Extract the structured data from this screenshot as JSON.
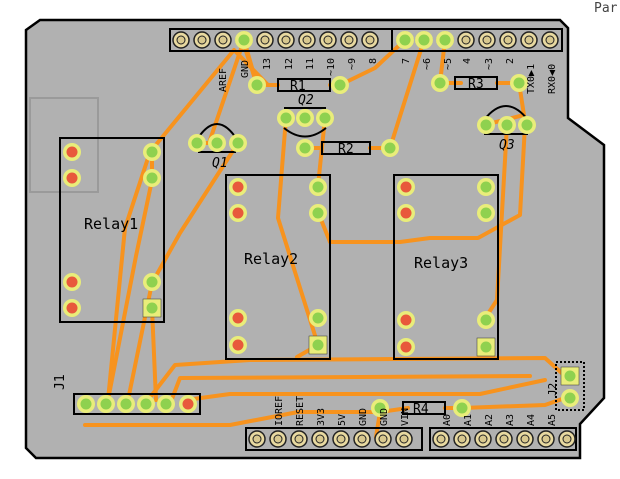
{
  "corner_text": "Par",
  "colors": {
    "board": "#b1b1b1",
    "board_edge": "#000000",
    "trace": "#f7931e",
    "pad_green": "#8fd14f",
    "pad_red": "#e8593c",
    "pad_ring": "#e9ed7a",
    "header_pad": "#e8d9a0",
    "silk": "#000000"
  },
  "top_header_labels": [
    "AREF",
    "GND",
    "13",
    "12",
    "11",
    "~10",
    "~9",
    "8",
    "7",
    "~6",
    "~5",
    "4",
    "~3",
    "2",
    "TX0▶1",
    "RX0◀0"
  ],
  "bottom_header_labels": [
    "IOREF",
    "RESET",
    "3V3",
    "5V",
    "GND",
    "GND",
    "VIN",
    "A0",
    "A1",
    "A2",
    "A3",
    "A4",
    "A5"
  ],
  "relays": [
    {
      "label": "Relay1"
    },
    {
      "label": "Relay2"
    },
    {
      "label": "Relay3"
    }
  ],
  "transistors": [
    {
      "label": "Q1"
    },
    {
      "label": "Q2"
    },
    {
      "label": "Q3"
    }
  ],
  "resistors": [
    {
      "label": "R1"
    },
    {
      "label": "R2"
    },
    {
      "label": "R3"
    },
    {
      "label": "R4"
    }
  ],
  "connectors": [
    {
      "label": "J1"
    },
    {
      "label": "J2"
    }
  ]
}
